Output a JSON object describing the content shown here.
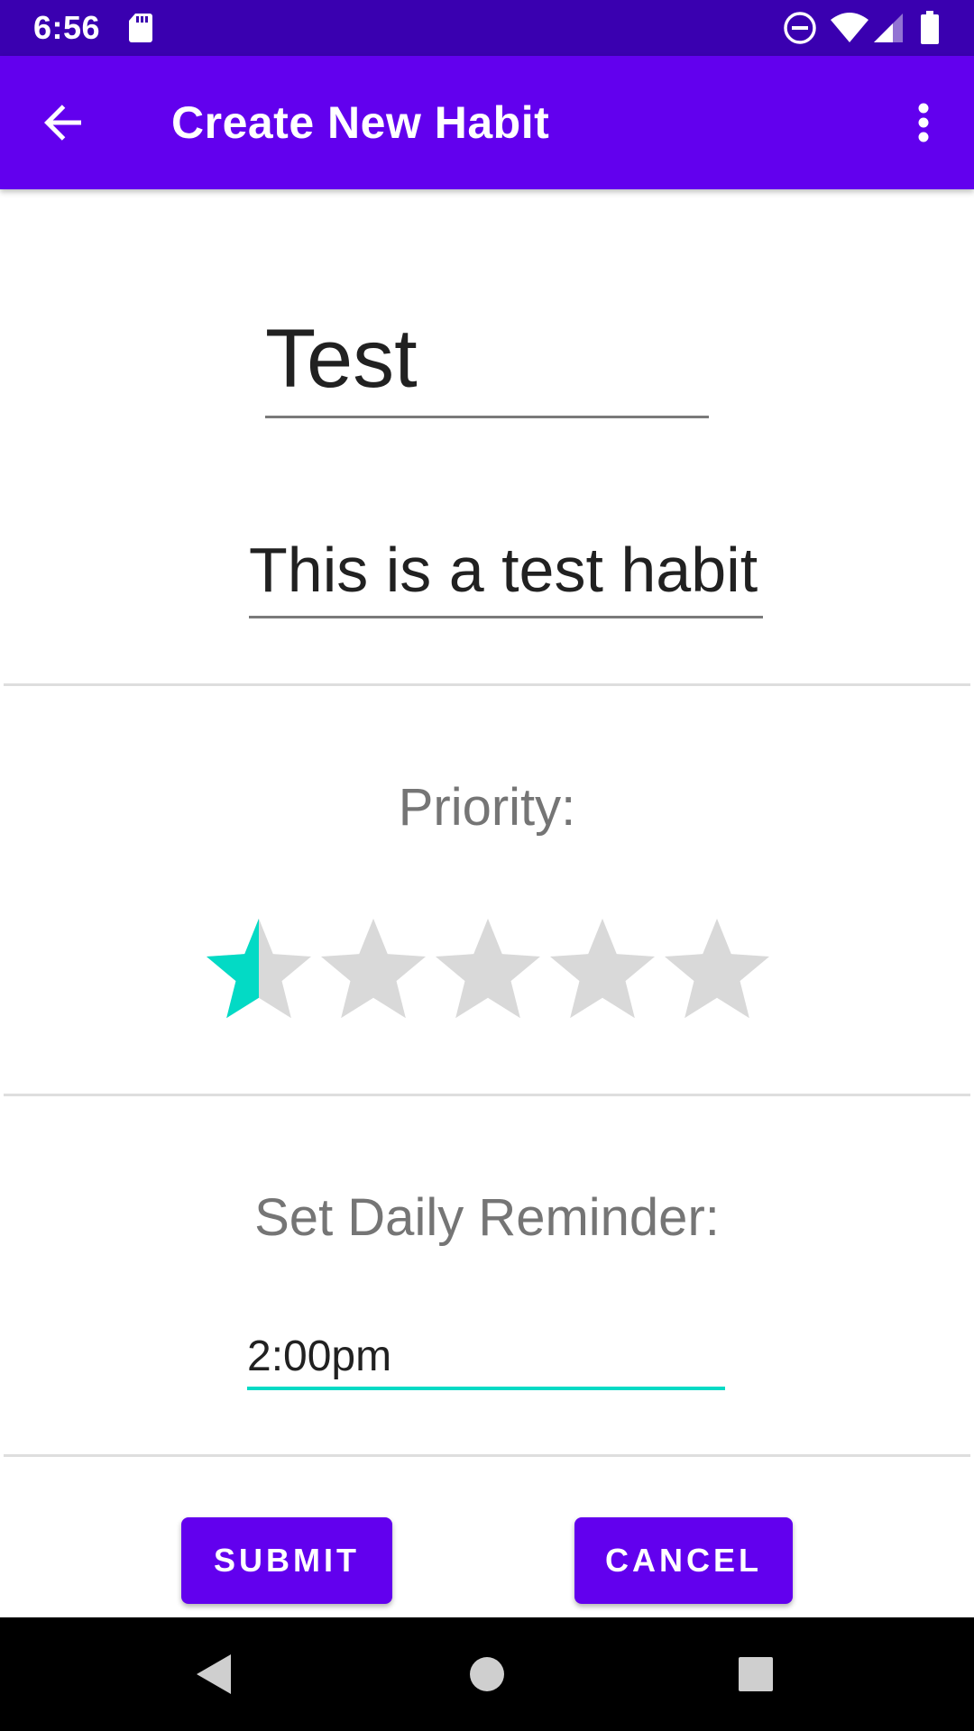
{
  "status_bar": {
    "time": "6:56",
    "icons": [
      "sd-card-icon",
      "do-not-disturb-icon",
      "wifi-icon",
      "signal-icon",
      "battery-icon"
    ]
  },
  "app_bar": {
    "title": "Create New Habit",
    "back_icon": "arrow-back-icon",
    "menu_icon": "more-vert-icon"
  },
  "form": {
    "habit_name": {
      "value": "Test",
      "placeholder": ""
    },
    "habit_description": {
      "value": "This is a test habit",
      "placeholder": ""
    },
    "priority": {
      "label": "Priority:",
      "rating": 0.5,
      "max": 5
    },
    "reminder": {
      "label": "Set Daily Reminder:",
      "value": "2:00pm"
    },
    "submit_label": "SUBMIT",
    "cancel_label": "CANCEL"
  },
  "colors": {
    "status_bar": "#3a00b0",
    "app_bar": "#6200ee",
    "accent": "#03dac5",
    "star_empty": "#d9d9d9",
    "button": "#6200ee"
  },
  "nav_bar": {
    "icons": [
      "nav-back-icon",
      "nav-home-icon",
      "nav-recents-icon"
    ]
  }
}
